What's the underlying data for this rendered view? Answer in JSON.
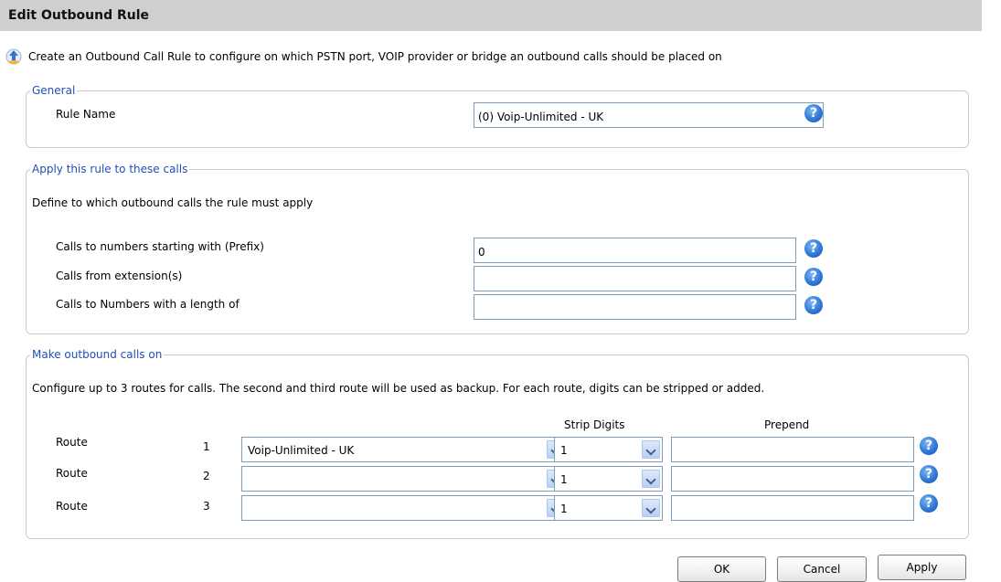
{
  "window": {
    "title": "Edit Outbound Rule"
  },
  "intro": {
    "text": "Create an Outbound Call Rule to configure on which PSTN port, VOIP provider or bridge an outbound calls should be placed on",
    "icon": "arrow-info-icon"
  },
  "general": {
    "legend": "General",
    "rule_name_label": "Rule Name",
    "rule_name_value": "(0) Voip-Unlimited - UK"
  },
  "apply": {
    "legend": "Apply this rule to these calls",
    "description": "Define to which outbound calls the rule must apply",
    "prefix_label": "Calls to numbers starting with (Prefix)",
    "prefix_value": "0",
    "extensions_label": "Calls from extension(s)",
    "extensions_value": "",
    "length_label": "Calls to Numbers with a length of",
    "length_value": ""
  },
  "routes": {
    "legend": "Make outbound calls on",
    "description": "Configure up to 3 routes for calls. The second and third route will be used as backup. For each route, digits can be stripped or added.",
    "strip_header": "Strip Digits",
    "prepend_header": "Prepend",
    "rows": [
      {
        "label": "Route",
        "number": "1",
        "provider": "Voip-Unlimited - UK",
        "strip": "1",
        "prepend": ""
      },
      {
        "label": "Route",
        "number": "2",
        "provider": "",
        "strip": "1",
        "prepend": ""
      },
      {
        "label": "Route",
        "number": "3",
        "provider": "",
        "strip": "1",
        "prepend": ""
      }
    ]
  },
  "help_glyph": "?",
  "buttons": {
    "ok": "OK",
    "cancel": "Cancel",
    "apply": "Apply"
  },
  "colors": {
    "legend": "#1f4fb8",
    "titlebar": "#cfcfcf",
    "help": "#2f78d8"
  }
}
